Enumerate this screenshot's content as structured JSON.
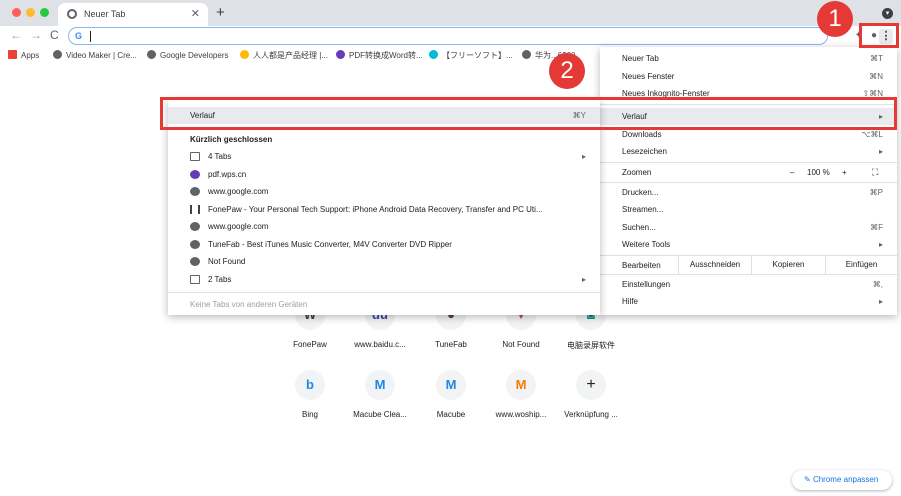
{
  "window": {
    "tab_title": "Neuer Tab",
    "new_tab_symbol": "+",
    "close_symbol": "✕"
  },
  "toolbar": {
    "back": "←",
    "forward": "→",
    "reload": "C",
    "omnibox_g": "G",
    "menu_symbol": "⋮"
  },
  "bookmarks": [
    {
      "label": "Apps",
      "color": "#ea4335"
    },
    {
      "label": "Video Maker | Cre...",
      "color": "#5f6368"
    },
    {
      "label": "Google Developers",
      "color": "#5f6368"
    },
    {
      "label": "人人都是产品经理 |...",
      "color": "#fbbc04"
    },
    {
      "label": "PDF转换成Word转...",
      "color": "#673ab7"
    },
    {
      "label": "【フリーソフト】...",
      "color": "#00bcd4"
    },
    {
      "label": "华为...6200",
      "color": "#5f6368"
    }
  ],
  "chrome_menu": {
    "items": [
      {
        "label": "Neuer Tab",
        "shortcut": "⌘T"
      },
      {
        "label": "Neues Fenster",
        "shortcut": "⌘N"
      },
      {
        "label": "Neues Inkognito-Fenster",
        "shortcut": "⇧⌘N"
      },
      {
        "label": "Verlauf",
        "shortcut": "▸"
      },
      {
        "label": "Downloads",
        "shortcut": "⌥⌘L"
      },
      {
        "label": "Lesezeichen",
        "shortcut": "▸"
      },
      {
        "label": "Zoomen",
        "zoom_minus": "–",
        "zoom_value": "100 %",
        "zoom_plus": "+",
        "fullscreen": "⛶"
      },
      {
        "label": "Drucken...",
        "shortcut": "⌘P"
      },
      {
        "label": "Streamen...",
        "shortcut": ""
      },
      {
        "label": "Suchen...",
        "shortcut": "⌘F"
      },
      {
        "label": "Weitere Tools",
        "shortcut": "▸"
      },
      {
        "label": "Bearbeiten",
        "cut": "Ausschneiden",
        "copy": "Kopieren",
        "paste": "Einfügen"
      },
      {
        "label": "Einstellungen",
        "shortcut": "⌘,"
      },
      {
        "label": "Hilfe",
        "shortcut": "▸"
      }
    ]
  },
  "history_menu": {
    "header": {
      "label": "Verlauf",
      "shortcut": "⌘Y"
    },
    "recent_title": "Kürzlich geschlossen",
    "items": [
      {
        "label": "4 Tabs",
        "icon": "folder-icon",
        "arrow": "▸"
      },
      {
        "label": "pdf.wps.cn",
        "icon": "pdf-icon",
        "arrow": ""
      },
      {
        "label": "www.google.com",
        "icon": "globe-icon",
        "arrow": ""
      },
      {
        "label": "FonePaw - Your Personal Tech Support: iPhone  Android Data Recovery, Transfer and PC Uti...",
        "icon": "fonepaw-icon",
        "arrow": ""
      },
      {
        "label": "www.google.com",
        "icon": "globe-icon",
        "arrow": ""
      },
      {
        "label": "TuneFab - Best iTunes Music Converter, M4V Converter  DVD Ripper",
        "icon": "globe-icon",
        "arrow": ""
      },
      {
        "label": "Not Found",
        "icon": "globe-icon",
        "arrow": ""
      },
      {
        "label": "2 Tabs",
        "icon": "folder-icon",
        "arrow": "▸"
      }
    ],
    "footer": "Keine Tabs von anderen Geräten"
  },
  "badges": {
    "one": "1",
    "two": "2"
  },
  "shortcuts_row1": [
    {
      "label": "FonePaw",
      "glyph": "W",
      "color": "#424242"
    },
    {
      "label": "www.baidu.c...",
      "glyph": "du",
      "color": "#3949ab"
    },
    {
      "label": "TuneFab",
      "glyph": "●",
      "color": "#5d4037"
    },
    {
      "label": "Not Found",
      "glyph": "▼",
      "color": "#e53935"
    },
    {
      "label": "电脑录屏软件",
      "glyph": "◙",
      "color": "#00897b"
    }
  ],
  "shortcuts_row2": [
    {
      "label": "Bing",
      "glyph": "b",
      "color": "#1e88e5"
    },
    {
      "label": "Macube Clea...",
      "glyph": "M",
      "color": "#1e88e5"
    },
    {
      "label": "Macube",
      "glyph": "M",
      "color": "#1e88e5"
    },
    {
      "label": "www.woship...",
      "glyph": "M",
      "color": "#f57c00"
    },
    {
      "label": "Verknüpfung ...",
      "glyph": "+",
      "color": "#202124"
    }
  ],
  "customize": {
    "label": "Chrome anpassen",
    "icon": "✎"
  },
  "colors": {
    "highlight_red": "#e53935",
    "accent_blue": "#1a73e8"
  }
}
